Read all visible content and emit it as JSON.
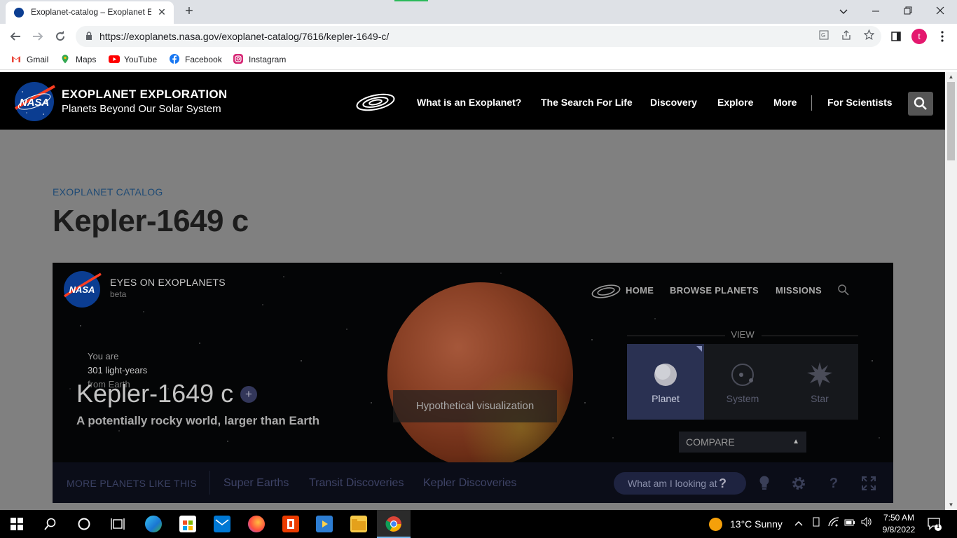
{
  "browser": {
    "tab_title": "Exoplanet-catalog – Exoplanet Ex",
    "tab_close": "✕",
    "new_tab": "+",
    "url": "https://exoplanets.nasa.gov/exoplanet-catalog/7616/kepler-1649-c/",
    "profile_initial": "t",
    "bookmarks": [
      {
        "label": "Gmail",
        "icon": "gmail-icon",
        "color": "#ea4335"
      },
      {
        "label": "Maps",
        "icon": "maps-icon",
        "color": "#34a853"
      },
      {
        "label": "YouTube",
        "icon": "youtube-icon",
        "color": "#ff0000"
      },
      {
        "label": "Facebook",
        "icon": "facebook-icon",
        "color": "#1877f2"
      },
      {
        "label": "Instagram",
        "icon": "instagram-icon",
        "color": "#d62976"
      }
    ]
  },
  "header": {
    "logo": "NASA",
    "title": "EXOPLANET EXPLORATION",
    "subtitle": "Planets Beyond Our Solar System",
    "nav": [
      "What is an Exoplanet?",
      "The Search For Life",
      "Discovery",
      "Explore",
      "More"
    ],
    "for_scientists": "For Scientists"
  },
  "page": {
    "breadcrumb": "EXOPLANET CATALOG",
    "title": "Kepler-1649 c"
  },
  "embed": {
    "logo": "NASA",
    "app_title": "EYES ON EXOPLANETS",
    "beta": "beta",
    "nav": [
      "HOME",
      "BROWSE PLANETS",
      "MISSIONS"
    ],
    "distance": {
      "you_are": "You are",
      "value": "301 light-years",
      "from": "from Earth"
    },
    "planet_name": "Kepler-1649 c",
    "add": "+",
    "description": "A potentially rocky world, larger than Earth",
    "hypothetical": "Hypothetical visualization",
    "view_label": "VIEW",
    "views": [
      {
        "label": "Planet",
        "active": true
      },
      {
        "label": "System",
        "active": false
      },
      {
        "label": "Star",
        "active": false
      }
    ],
    "compare": "COMPARE",
    "more_label": "MORE PLANETS LIKE THIS",
    "categories": [
      "Super Earths",
      "Transit Discoveries",
      "Kepler Discoveries"
    ],
    "what_am_i": "What am I looking at",
    "what_q": "?",
    "help": "?"
  },
  "taskbar": {
    "weather": "13°C  Sunny",
    "time": "7:50 AM",
    "date": "9/8/2022",
    "notifications": "1"
  },
  "colors": {
    "accent_blue": "#1e4a75",
    "header_bg": "#000000",
    "page_overlay": "#808080",
    "active_view": "#2a3152"
  }
}
